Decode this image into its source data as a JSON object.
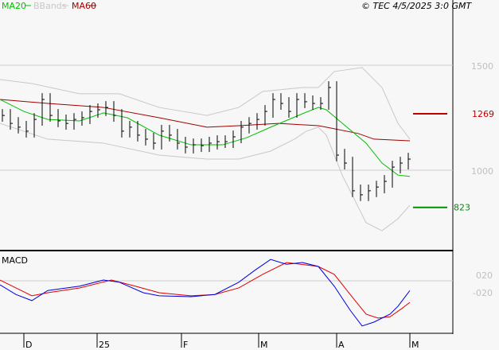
{
  "legend": [
    {
      "label": "MA20",
      "color": "#00c000"
    },
    {
      "label": "BBands",
      "color": "#c8c8c8"
    },
    {
      "label": "MA60",
      "color": "#a00000"
    }
  ],
  "copyright": "© TEC 4/5/2025 3:0 GMT",
  "chart_data": {
    "type": "line",
    "price": {
      "ylim": [
        650,
        1620
      ],
      "yticks": [
        {
          "value": 1500,
          "label": "1500"
        },
        {
          "value": 1000,
          "label": "1000"
        }
      ],
      "close_step": 2,
      "closes": [
        1261,
        1223,
        1205,
        1186,
        1242,
        1337,
        1261,
        1235,
        1223,
        1242,
        1250,
        1280,
        1288,
        1299,
        1261,
        1186,
        1205,
        1167,
        1148,
        1129,
        1186,
        1167,
        1129,
        1110,
        1121,
        1117,
        1129,
        1136,
        1136,
        1159,
        1205,
        1223,
        1242,
        1280,
        1337,
        1318,
        1280,
        1337,
        1326,
        1318,
        1318,
        1394,
        1072,
        1034,
        902,
        883,
        902,
        920,
        947,
        1015,
        1034,
        1053
      ],
      "ma20": [
        [
          0,
          1337
        ],
        [
          6,
          1280
        ],
        [
          12,
          1242
        ],
        [
          20,
          1235
        ],
        [
          26,
          1273
        ],
        [
          32,
          1250
        ],
        [
          40,
          1167
        ],
        [
          48,
          1121
        ],
        [
          56,
          1121
        ],
        [
          62,
          1155
        ],
        [
          68,
          1205
        ],
        [
          76,
          1269
        ],
        [
          80,
          1299
        ],
        [
          82,
          1288
        ],
        [
          86,
          1224
        ],
        [
          92,
          1129
        ],
        [
          96,
          1034
        ],
        [
          100,
          977
        ],
        [
          103,
          970
        ]
      ],
      "ma60": [
        [
          0,
          1337
        ],
        [
          12,
          1318
        ],
        [
          26,
          1299
        ],
        [
          40,
          1250
        ],
        [
          52,
          1205
        ],
        [
          60,
          1212
        ],
        [
          70,
          1223
        ],
        [
          80,
          1212
        ],
        [
          82,
          1205
        ],
        [
          90,
          1175
        ],
        [
          94,
          1148
        ],
        [
          103,
          1140
        ]
      ],
      "bb_upper": [
        [
          0,
          1432
        ],
        [
          8,
          1413
        ],
        [
          20,
          1364
        ],
        [
          30,
          1364
        ],
        [
          40,
          1299
        ],
        [
          52,
          1261
        ],
        [
          60,
          1299
        ],
        [
          66,
          1375
        ],
        [
          76,
          1394
        ],
        [
          80,
          1394
        ],
        [
          84,
          1470
        ],
        [
          91,
          1489
        ],
        [
          96,
          1394
        ],
        [
          100,
          1224
        ],
        [
          103,
          1148
        ]
      ],
      "bb_lower": [
        [
          0,
          1223
        ],
        [
          12,
          1148
        ],
        [
          26,
          1129
        ],
        [
          40,
          1072
        ],
        [
          52,
          1053
        ],
        [
          60,
          1053
        ],
        [
          68,
          1091
        ],
        [
          74,
          1148
        ],
        [
          77,
          1186
        ],
        [
          80,
          1205
        ],
        [
          82,
          1167
        ],
        [
          86,
          977
        ],
        [
          92,
          750
        ],
        [
          96,
          712
        ],
        [
          100,
          769
        ],
        [
          103,
          833
        ]
      ],
      "resistance": {
        "value": 1269,
        "label": "1269",
        "color": "#c00000"
      },
      "support": {
        "value": 823,
        "label": "823",
        "color": "#009000"
      }
    },
    "macd": {
      "title": "MACD",
      "ylim": [
        -1.1,
        0.8
      ],
      "yticks": [
        {
          "value": 0.2,
          "label": "020"
        },
        {
          "value": -0.2,
          "label": "-020"
        }
      ],
      "macd": [
        [
          0,
          -0.02
        ],
        [
          4,
          -0.24
        ],
        [
          8,
          -0.38
        ],
        [
          12,
          -0.15
        ],
        [
          20,
          -0.05
        ],
        [
          26,
          0.09
        ],
        [
          30,
          0.04
        ],
        [
          36,
          -0.2
        ],
        [
          40,
          -0.27
        ],
        [
          48,
          -0.29
        ],
        [
          54,
          -0.24
        ],
        [
          60,
          0.04
        ],
        [
          64,
          0.31
        ],
        [
          68,
          0.56
        ],
        [
          72,
          0.45
        ],
        [
          76,
          0.49
        ],
        [
          80,
          0.4
        ],
        [
          84,
          -0.05
        ],
        [
          88,
          -0.6
        ],
        [
          91,
          -0.96
        ],
        [
          94,
          -0.87
        ],
        [
          98,
          -0.69
        ],
        [
          100,
          -0.51
        ],
        [
          103,
          -0.15
        ]
      ],
      "signal": [
        [
          0,
          0.09
        ],
        [
          4,
          -0.09
        ],
        [
          8,
          -0.27
        ],
        [
          12,
          -0.2
        ],
        [
          20,
          -0.09
        ],
        [
          28,
          0.09
        ],
        [
          34,
          -0.05
        ],
        [
          40,
          -0.2
        ],
        [
          48,
          -0.27
        ],
        [
          54,
          -0.24
        ],
        [
          60,
          -0.09
        ],
        [
          66,
          0.22
        ],
        [
          72,
          0.49
        ],
        [
          80,
          0.4
        ],
        [
          84,
          0.22
        ],
        [
          88,
          -0.24
        ],
        [
          92,
          -0.69
        ],
        [
          95,
          -0.78
        ],
        [
          98,
          -0.75
        ],
        [
          101,
          -0.56
        ],
        [
          103,
          -0.42
        ]
      ]
    },
    "xticks": [
      {
        "index": 6,
        "label": "D"
      },
      {
        "index": 24.4,
        "label": "25"
      },
      {
        "index": 45.6,
        "label": "F"
      },
      {
        "index": 65,
        "label": "M"
      },
      {
        "index": 84.6,
        "label": "A"
      },
      {
        "index": 103,
        "label": "M"
      }
    ]
  }
}
